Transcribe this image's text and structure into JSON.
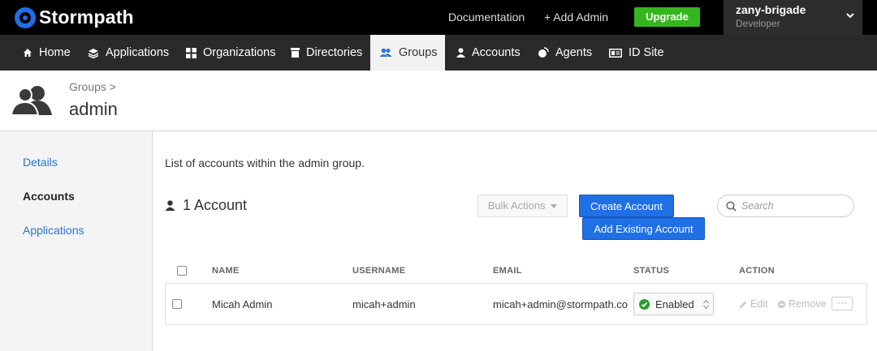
{
  "brand": {
    "name": "Stormpath"
  },
  "topbar": {
    "documentation": "Documentation",
    "add_admin": "+ Add Admin",
    "upgrade": "Upgrade",
    "tenant_name": "zany-brigade",
    "tenant_role": "Developer"
  },
  "nav": {
    "home": "Home",
    "applications": "Applications",
    "organizations": "Organizations",
    "directories": "Directories",
    "groups": "Groups",
    "accounts": "Accounts",
    "agents": "Agents",
    "id_site": "ID Site"
  },
  "header": {
    "breadcrumb": "Groups >",
    "title": "admin"
  },
  "sidebar": {
    "details": "Details",
    "accounts": "Accounts",
    "applications": "Applications"
  },
  "main": {
    "description": "List of accounts within the admin group.",
    "count_label": "1 Account",
    "bulk_actions": "Bulk Actions",
    "create_account": "Create Account",
    "add_existing": "Add Existing Account",
    "search_placeholder": "Search"
  },
  "table": {
    "headers": {
      "name": "NAME",
      "username": "USERNAME",
      "email": "EMAIL",
      "status": "STATUS",
      "action": "ACTION"
    },
    "rows": [
      {
        "name": "Micah Admin",
        "username": "micah+admin",
        "email": "micah+admin@stormpath.com",
        "status": "Enabled",
        "edit": "Edit",
        "remove": "Remove",
        "more": "···"
      }
    ]
  },
  "colors": {
    "accent": "#1f6fe5",
    "upgrade": "#35b61e",
    "enabled": "#2a9c2e"
  }
}
